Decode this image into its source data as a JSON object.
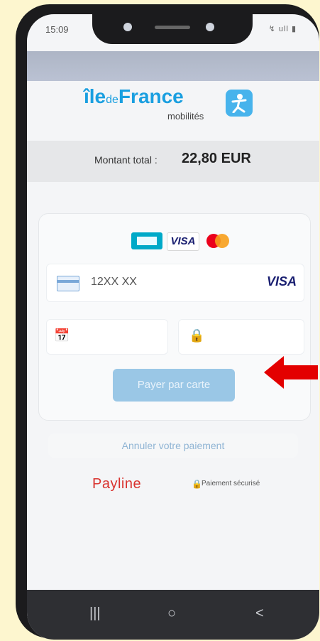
{
  "status_bar": {
    "time": "15:09",
    "icons": "↯ ull ▮"
  },
  "brand": {
    "name_part1": "île",
    "name_part2": "de",
    "name_part3": "France",
    "subtitle": "mobilités",
    "badge_icon": "person-icon",
    "color": "#1a9fe0"
  },
  "payment_summary": {
    "label": "Montant total :",
    "amount": "22,80 EUR"
  },
  "card_form": {
    "accepted_cards": [
      "CB",
      "VISA",
      "mastercard"
    ],
    "card_number_value": "12XX XX",
    "card_brand_detected": "VISA",
    "expiry_icon": "calendar-icon",
    "cvv_icon": "lock-icon",
    "pay_button_label": "Payer par carte"
  },
  "cancel_label": "Annuler votre paiement",
  "footer": {
    "provider_logo": "Payline",
    "secure_label": "Paiement sécurisé"
  },
  "nav": {
    "recents": "|||",
    "home": "○",
    "back": "<"
  },
  "colors": {
    "arrow": "#e30000",
    "pay_button": "#9ac7e6"
  }
}
